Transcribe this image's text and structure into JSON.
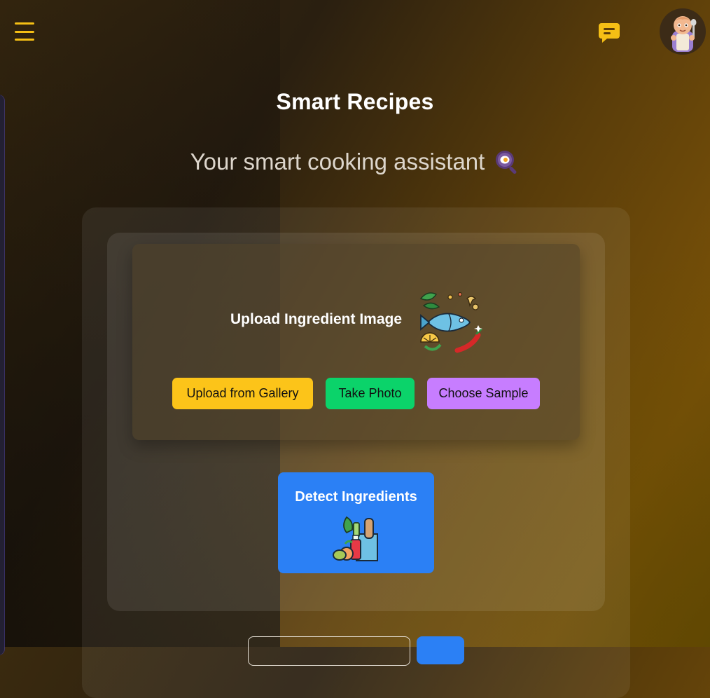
{
  "header": {
    "menu_icon": "hamburger-menu-icon",
    "chat_icon": "chat-bubble-icon",
    "avatar_icon": "chef-baby-avatar",
    "accent_color": "#f5bf15"
  },
  "hero": {
    "title": "Smart Recipes",
    "subtitle": "Your smart cooking assistant",
    "subtitle_icon": "frying-pan-egg-icon"
  },
  "upload": {
    "heading": "Upload Ingredient Image",
    "heading_icon": "ingredients-fish-vegetables-icon",
    "buttons": [
      {
        "label": "Upload from Gallery",
        "color": "#fcc419"
      },
      {
        "label": "Take Photo",
        "color": "#0bd36a"
      },
      {
        "label": "Choose Sample",
        "color": "#c77dff"
      }
    ]
  },
  "detect": {
    "label": "Detect Ingredients",
    "icon": "grocery-bag-icon",
    "color": "#2b80f5"
  }
}
